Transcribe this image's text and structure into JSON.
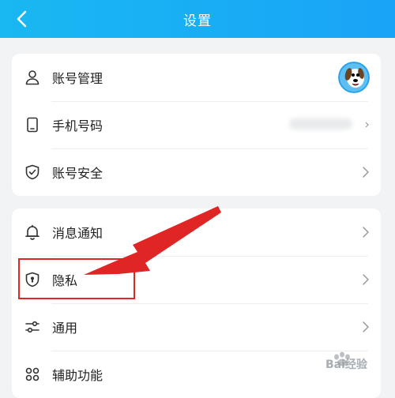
{
  "header": {
    "title": "设置"
  },
  "sections": [
    {
      "items": [
        {
          "label": "账号管理",
          "icon": "person-icon",
          "trailing": "avatar"
        },
        {
          "label": "手机号码",
          "icon": "phone-icon",
          "trailing": "masked-value"
        },
        {
          "label": "账号安全",
          "icon": "shield-check-icon",
          "trailing": "chevron-right-icon"
        }
      ]
    },
    {
      "items": [
        {
          "label": "消息通知",
          "icon": "bell-icon",
          "trailing": "chevron-right-icon"
        },
        {
          "label": "隐私",
          "icon": "privacy-shield-icon",
          "trailing": "chevron-right-icon"
        },
        {
          "label": "通用",
          "icon": "sliders-icon",
          "trailing": "chevron-right-icon"
        },
        {
          "label": "辅助功能",
          "icon": "grid-icon",
          "trailing": "chevron-right-icon"
        }
      ]
    }
  ],
  "annotation": {
    "highlight_color": "#e02525",
    "target": "隐私"
  },
  "watermark": {
    "text": "Bai经验",
    "sub": "验"
  },
  "colors": {
    "header": "#19b8f2",
    "background": "#f2f3f5",
    "card": "#ffffff"
  }
}
